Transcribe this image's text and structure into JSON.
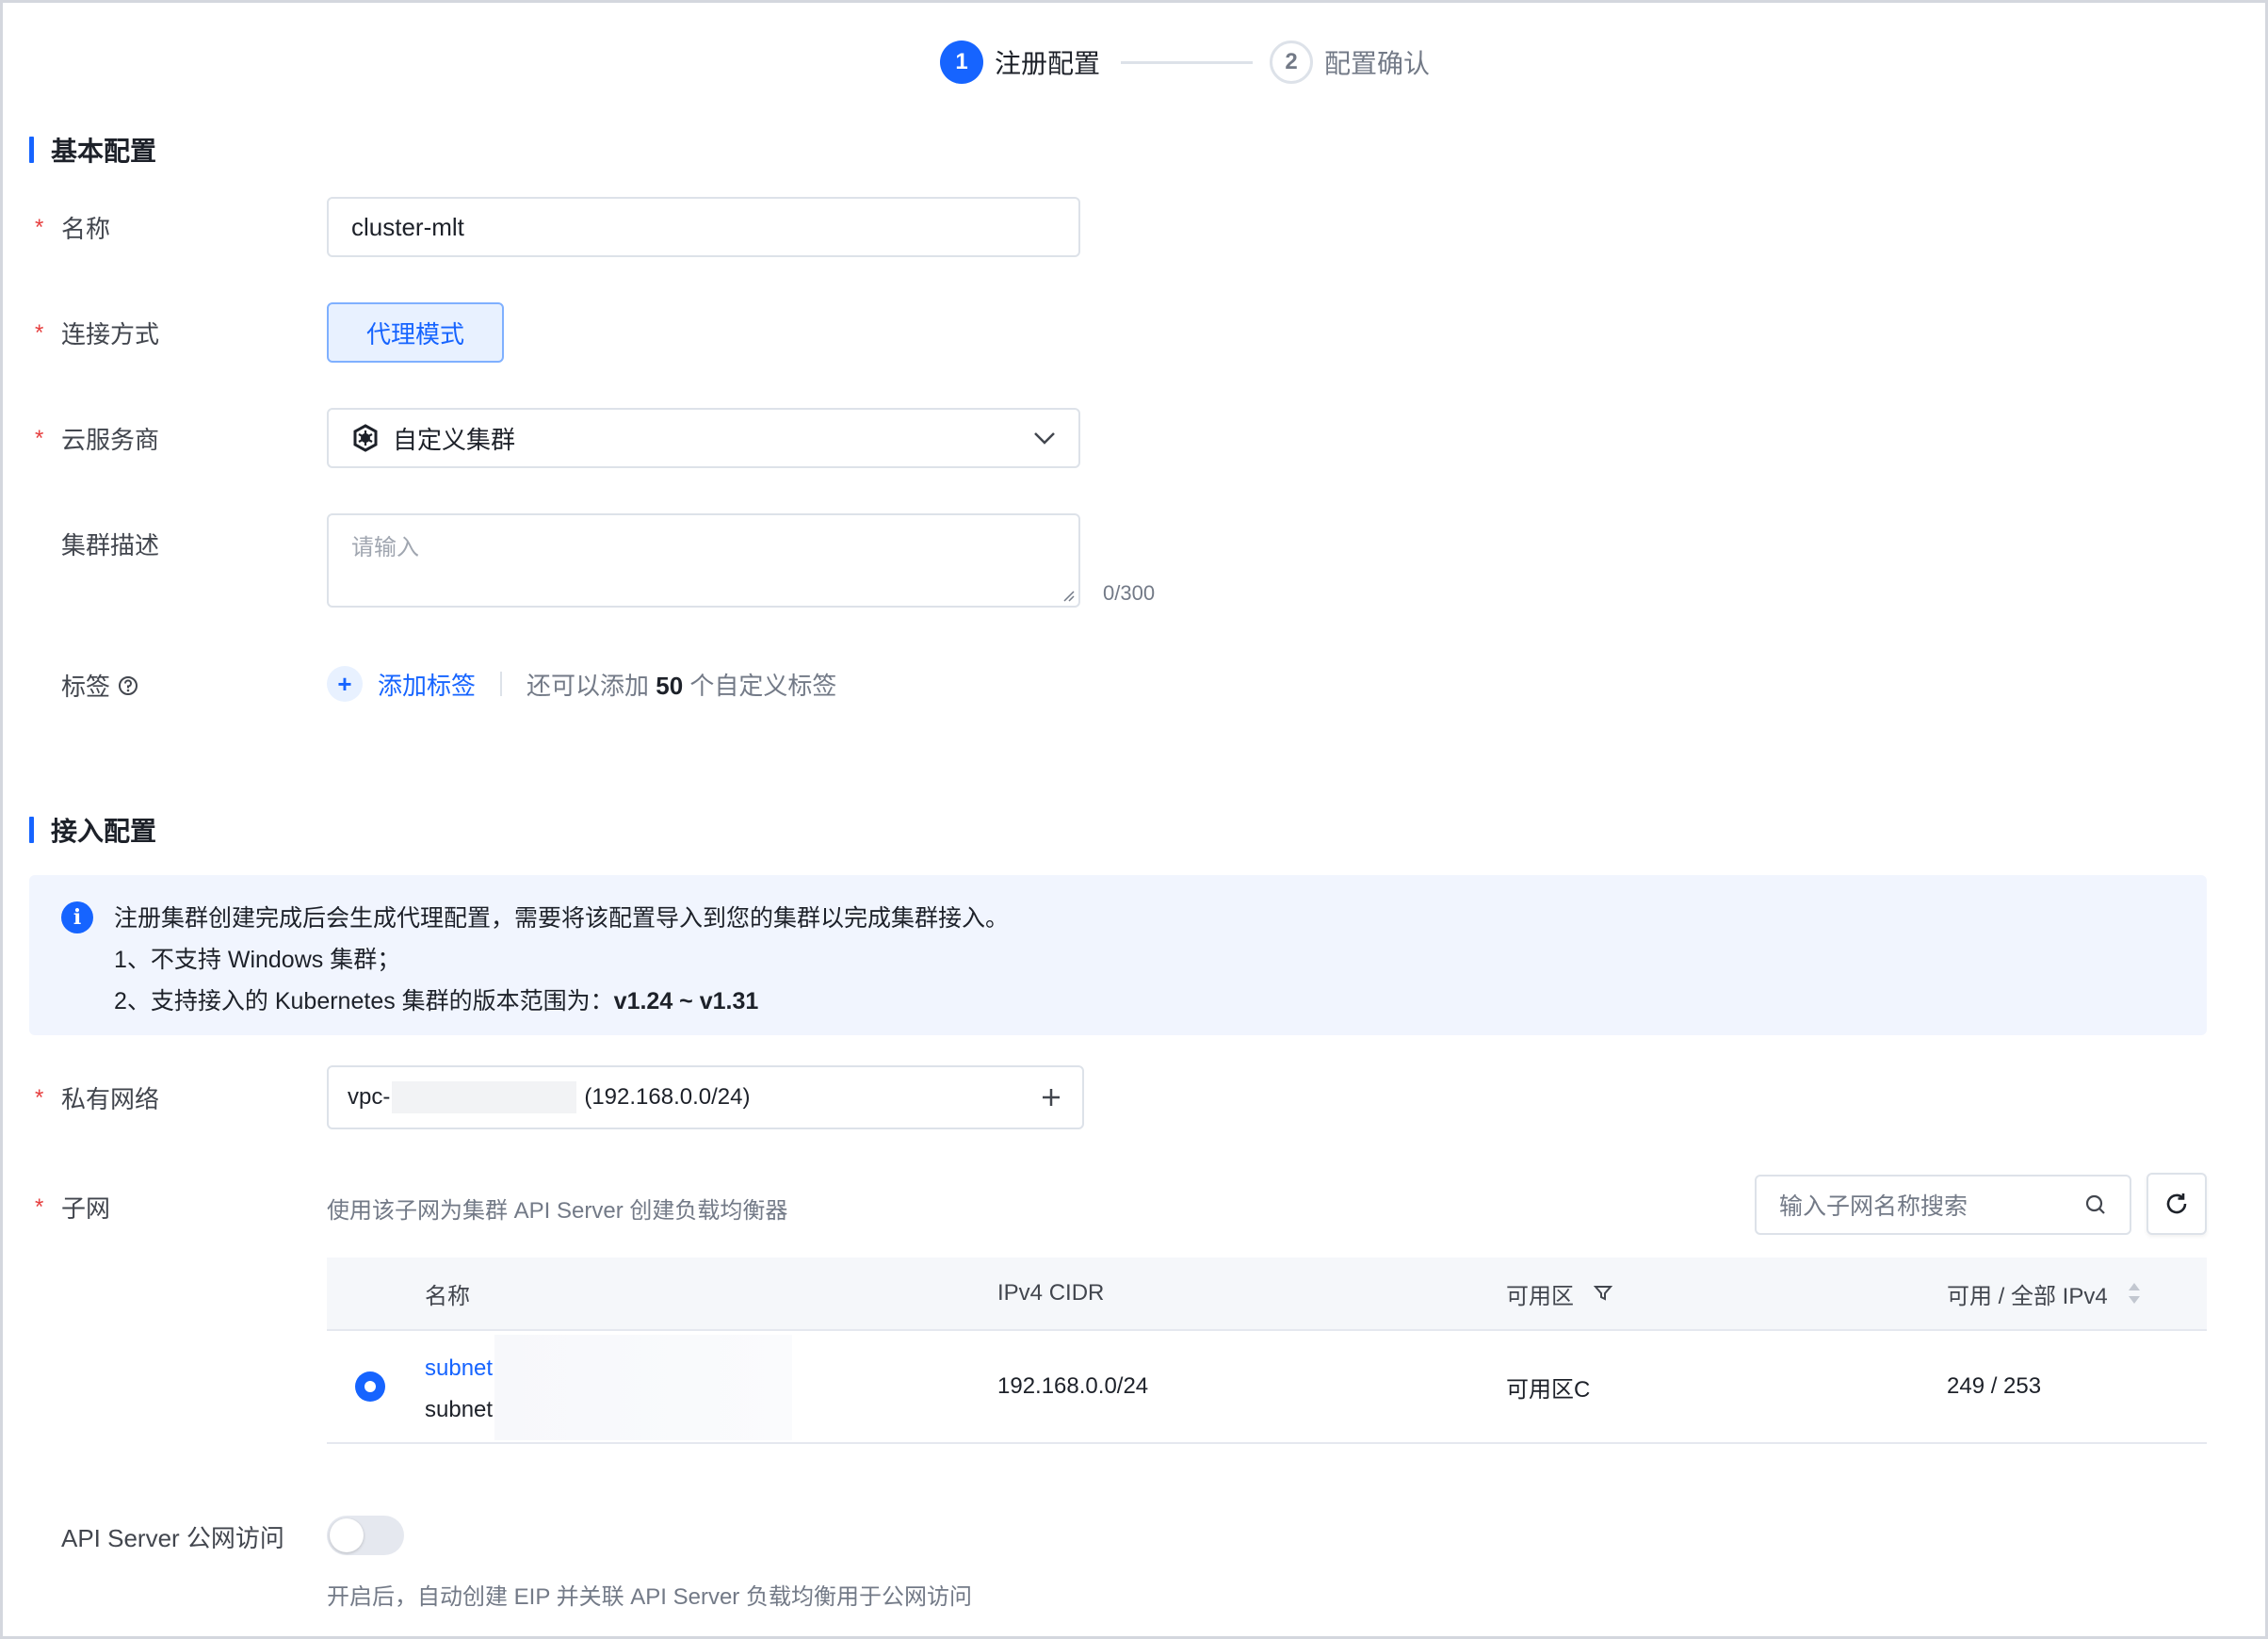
{
  "steps": [
    {
      "num": "1",
      "label": "注册配置"
    },
    {
      "num": "2",
      "label": "配置确认"
    }
  ],
  "basic": {
    "title": "基本配置",
    "name_label": "名称",
    "name_value": "cluster-mlt",
    "conn_label": "连接方式",
    "conn_mode": "代理模式",
    "provider_label": "云服务商",
    "provider_value": "自定义集群",
    "desc_label": "集群描述",
    "desc_placeholder": "请输入",
    "desc_counter": "0/300",
    "tag_label": "标签",
    "add_tag": "添加标签",
    "tag_hint_prefix": "还可以添加",
    "tag_hint_count": "50",
    "tag_hint_suffix": "个自定义标签"
  },
  "access": {
    "title": "接入配置",
    "info_line1": "注册集群创建完成后会生成代理配置，需要将该配置导入到您的集群以完成集群接入。",
    "info_line2": "1、不支持 Windows 集群；",
    "info_line3_prefix": "2、支持接入的 Kubernetes 集群的版本范围为：",
    "info_line3_version": "v1.24 ~ v1.31",
    "vpc_label": "私有网络",
    "vpc_prefix": "vpc-",
    "vpc_cidr": "(192.168.0.0/24)",
    "subnet_label": "子网",
    "subnet_hint": "使用该子网为集群 API Server 创建负载均衡器",
    "search_placeholder": "输入子网名称搜索",
    "columns": [
      "名称",
      "IPv4 CIDR",
      "可用区",
      "可用 / 全部 IPv4"
    ],
    "rows": [
      {
        "name": "subnet",
        "sub": "subnet",
        "cidr": "192.168.0.0/24",
        "zone": "可用区C",
        "ips": "249 / 253"
      }
    ],
    "api_label": "API Server 公网访问",
    "api_hint": "开启后，自动创建 EIP 并关联 API Server 负载均衡用于公网访问"
  },
  "colors": {
    "primary": "#1664ff",
    "required": "#e63f3f",
    "info_bg": "#f1f5fe"
  }
}
